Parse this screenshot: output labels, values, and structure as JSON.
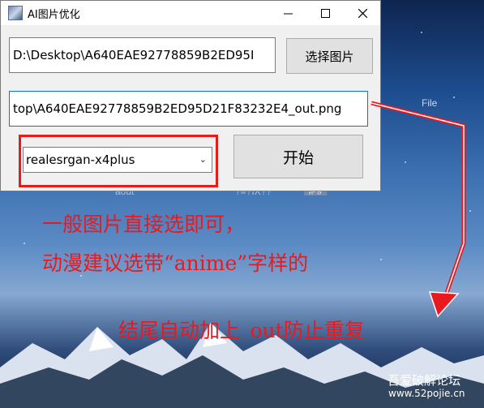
{
  "window": {
    "title": "AI图片优化",
    "input_path": "D:\\Desktop\\A640EAE92778859B2ED95I",
    "output_path": "top\\A640EAE92778859B2ED95D21F83232E4_out.png",
    "select_button": "选择图片",
    "start_button": "开始",
    "model_value": "realesrgan-x4plus"
  },
  "background": {
    "file_menu": "File",
    "faded_label_1": "aout",
    "faded_label_2": "?≡?IX??",
    "faded_label_3": "jpg"
  },
  "annotations": {
    "line1": "一般图片直接选即可，",
    "line2": "动漫建议选带“anime”字样的",
    "line3": "结尾自动加上_out防止重复",
    "color": "#e8191f"
  },
  "watermark": {
    "site_name": "吾爱破解论坛",
    "site_url": "www.52pojie.cn"
  }
}
